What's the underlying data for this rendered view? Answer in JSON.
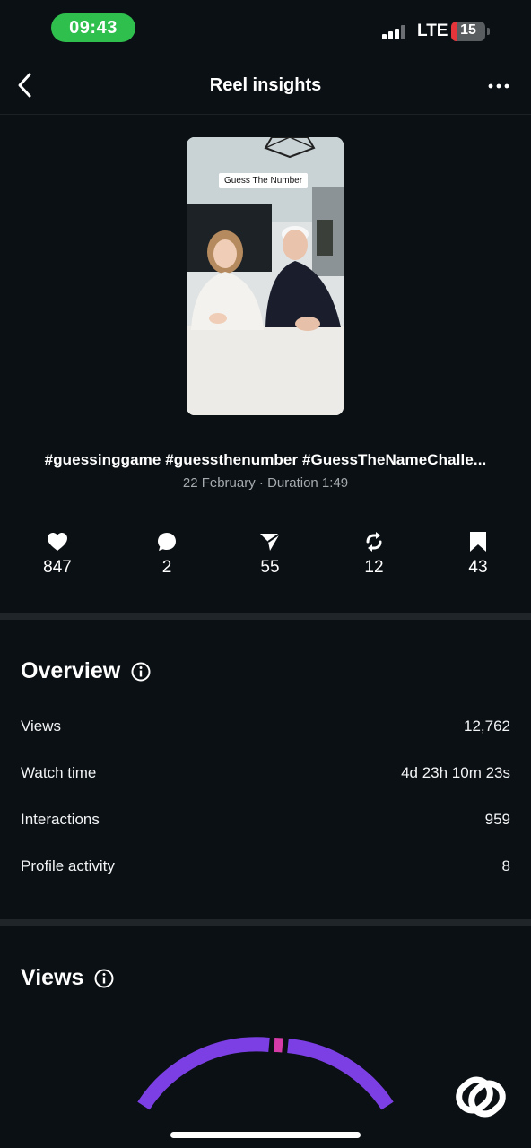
{
  "status_bar": {
    "time": "09:43",
    "network": "LTE",
    "battery_percent": "15",
    "battery_level": 0.15,
    "battery_color": "#e5353a",
    "time_pill_color": "#2fbf4d"
  },
  "nav": {
    "back_icon": "chevron-left-icon",
    "title": "Reel insights",
    "more_icon": "more-horizontal-icon"
  },
  "reel": {
    "thumbnail_text": "Guess The Number",
    "caption": "#guessinggame  #guessthenumber #GuessTheNameChalle...",
    "meta": "22 February · Duration 1:49"
  },
  "metrics": [
    {
      "icon": "heart-icon",
      "value": "847"
    },
    {
      "icon": "comment-icon",
      "value": "2"
    },
    {
      "icon": "share-icon",
      "value": "55"
    },
    {
      "icon": "repost-icon",
      "value": "12"
    },
    {
      "icon": "bookmark-icon",
      "value": "43"
    }
  ],
  "overview": {
    "title": "Overview",
    "info_icon": "info-icon",
    "rows": [
      {
        "label": "Views",
        "value": "12,762"
      },
      {
        "label": "Watch time",
        "value": "4d 23h 10m 23s"
      },
      {
        "label": "Interactions",
        "value": "959"
      },
      {
        "label": "Profile activity",
        "value": "8"
      }
    ]
  },
  "views_section": {
    "title": "Views",
    "info_icon": "info-icon",
    "gauge_colors": {
      "primary": "#7b3fe4",
      "secondary": "#d63ba8"
    }
  },
  "watermark_icon": "app-logo-icon"
}
